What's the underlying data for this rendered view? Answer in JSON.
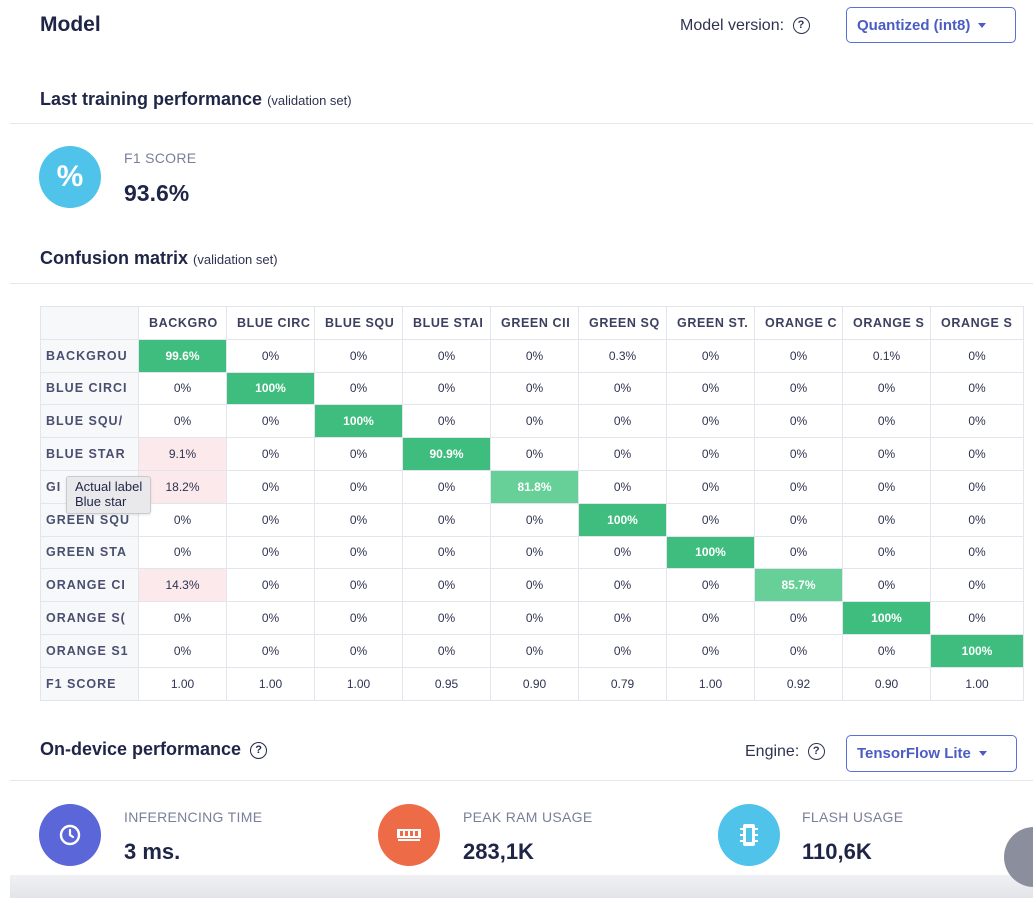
{
  "header": {
    "title": "Model",
    "model_version_label": "Model version:",
    "model_version_value": "Quantized (int8)"
  },
  "training": {
    "title": "Last training performance",
    "subtitle": "(validation set)",
    "f1_label": "F1 SCORE",
    "f1_value": "93.6%"
  },
  "confusion": {
    "title": "Confusion matrix",
    "subtitle": "(validation set)",
    "columns": [
      "BACKGRO",
      "BLUE CIRC",
      "BLUE SQU",
      "BLUE STAI",
      "GREEN CII",
      "GREEN SQ",
      "GREEN ST.",
      "ORANGE C",
      "ORANGE S",
      "ORANGE S"
    ],
    "rows": [
      {
        "label": "BACKGROU",
        "cells": [
          "99.6%",
          "0%",
          "0%",
          "0%",
          "0%",
          "0.3%",
          "0%",
          "0%",
          "0.1%",
          "0%"
        ]
      },
      {
        "label": "BLUE CIRCI",
        "cells": [
          "0%",
          "100%",
          "0%",
          "0%",
          "0%",
          "0%",
          "0%",
          "0%",
          "0%",
          "0%"
        ]
      },
      {
        "label": "BLUE SQU/",
        "cells": [
          "0%",
          "0%",
          "100%",
          "0%",
          "0%",
          "0%",
          "0%",
          "0%",
          "0%",
          "0%"
        ]
      },
      {
        "label": "BLUE STAR",
        "cells": [
          "9.1%",
          "0%",
          "0%",
          "90.9%",
          "0%",
          "0%",
          "0%",
          "0%",
          "0%",
          "0%"
        ]
      },
      {
        "label": "GI",
        "cells": [
          "18.2%",
          "0%",
          "0%",
          "0%",
          "81.8%",
          "0%",
          "0%",
          "0%",
          "0%",
          "0%"
        ]
      },
      {
        "label": "GREEN SQU",
        "cells": [
          "0%",
          "0%",
          "0%",
          "0%",
          "0%",
          "100%",
          "0%",
          "0%",
          "0%",
          "0%"
        ]
      },
      {
        "label": "GREEN STA",
        "cells": [
          "0%",
          "0%",
          "0%",
          "0%",
          "0%",
          "0%",
          "100%",
          "0%",
          "0%",
          "0%"
        ]
      },
      {
        "label": "ORANGE CI",
        "cells": [
          "14.3%",
          "0%",
          "0%",
          "0%",
          "0%",
          "0%",
          "0%",
          "85.7%",
          "0%",
          "0%"
        ]
      },
      {
        "label": "ORANGE S(",
        "cells": [
          "0%",
          "0%",
          "0%",
          "0%",
          "0%",
          "0%",
          "0%",
          "0%",
          "100%",
          "0%"
        ]
      },
      {
        "label": "ORANGE S1",
        "cells": [
          "0%",
          "0%",
          "0%",
          "0%",
          "0%",
          "0%",
          "0%",
          "0%",
          "0%",
          "100%"
        ]
      }
    ],
    "f1_row": {
      "label": "F1 SCORE",
      "cells": [
        "1.00",
        "1.00",
        "1.00",
        "0.95",
        "0.90",
        "0.79",
        "1.00",
        "0.92",
        "0.90",
        "1.00"
      ]
    },
    "tooltip": {
      "line1": "Actual label",
      "line2": "Blue star"
    }
  },
  "ondevice": {
    "title": "On-device performance",
    "engine_label": "Engine:",
    "engine_value": "TensorFlow Lite",
    "metrics": [
      {
        "label": "INFERENCING TIME",
        "value": "3 ms.",
        "icon": "clock-icon",
        "color": "#5b67d8"
      },
      {
        "label": "PEAK RAM USAGE",
        "value": "283,1K",
        "icon": "ram-icon",
        "color": "#ee6b47"
      },
      {
        "label": "FLASH USAGE",
        "value": "110,6K",
        "icon": "chip-icon",
        "color": "#4fc3ea"
      }
    ]
  },
  "colors": {
    "accent": "#4b5cc4",
    "good": "#3ebd7e",
    "bad": "#fbe9ec",
    "f1_circle": "#4fc3ea"
  }
}
